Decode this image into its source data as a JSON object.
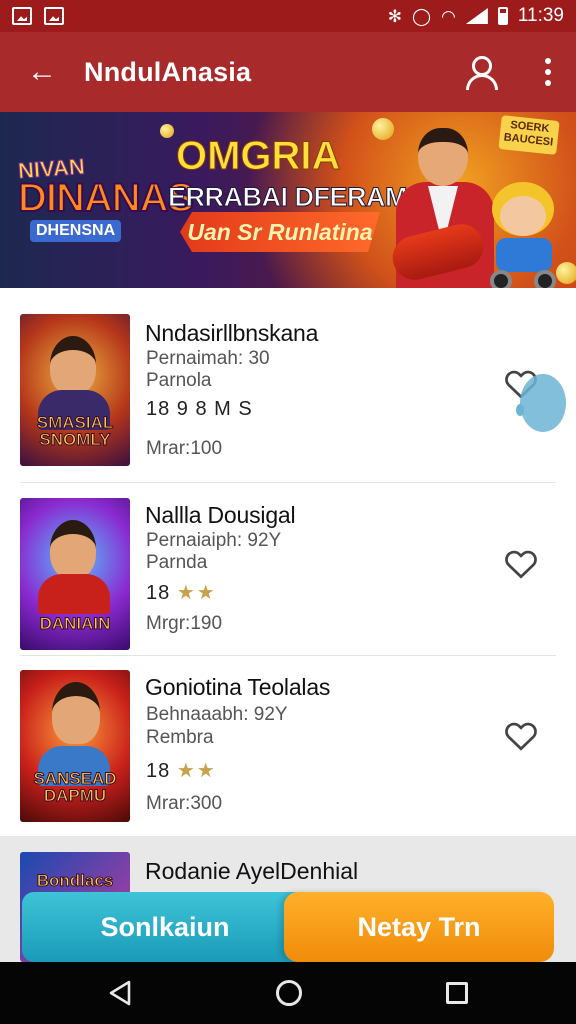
{
  "status_bar": {
    "time": "11:39",
    "icons": [
      "image-icon",
      "gallery-icon",
      "bluetooth-icon",
      "alarm-icon",
      "wifi-icon",
      "signal-icon",
      "battery-icon"
    ]
  },
  "app_bar": {
    "title": "NndulAnasia",
    "back_icon": "arrow-left-icon",
    "account_icon": "user-icon",
    "menu_icon": "more-vertical-icon"
  },
  "banner": {
    "logo_top": "NIVAN",
    "logo_main": "DINANAS",
    "logo_tag": "DHENSNA",
    "headline": "OMGRIA",
    "subline": "ERRABAI DFERAMASY",
    "ribbon": "Uan Sr Runlatina",
    "badge": "SOERK BAUCESI"
  },
  "items": [
    {
      "title": "Nndasirllbnskana",
      "line1": "Pernaimah: 30",
      "line2": "Parnola",
      "line3": "18 9 8 M S",
      "price": "Mrar:100",
      "cover_title": "SMASIAL SNOMLY",
      "favorite_icon": "heart-outline-icon"
    },
    {
      "title": "Nallla Dousigal",
      "line1": "Pernaiaiph: 92Y",
      "line2": "Parnda",
      "line3": "18",
      "stars": "★★",
      "price": "Mrgr:190",
      "cover_title": "DANIAIN",
      "favorite_icon": "heart-outline-icon"
    },
    {
      "title": "Goniotina Teolalas",
      "line1": "Behnaaabh: 92Y",
      "line2": "Rembra",
      "line3": "18",
      "stars": "★★",
      "price": "Mrar:300",
      "cover_title": "SANSEAD DAPMU",
      "favorite_icon": "heart-outline-icon"
    },
    {
      "title": "Rodanie AyelDenhial",
      "cover_title": "Bondlacs"
    }
  ],
  "actions": {
    "left_label": "Sonlkaiun",
    "right_label": "Netay Trn"
  },
  "nav_bar": {
    "back_icon": "nav-back-icon",
    "home_icon": "nav-home-icon",
    "recents_icon": "nav-recents-icon"
  },
  "colors": {
    "app_bar": "#a82a2a",
    "status_bar": "#9e1b1b",
    "action_left": "#2bb3cc",
    "action_right": "#f49a14",
    "stars": "#c8a24a"
  }
}
